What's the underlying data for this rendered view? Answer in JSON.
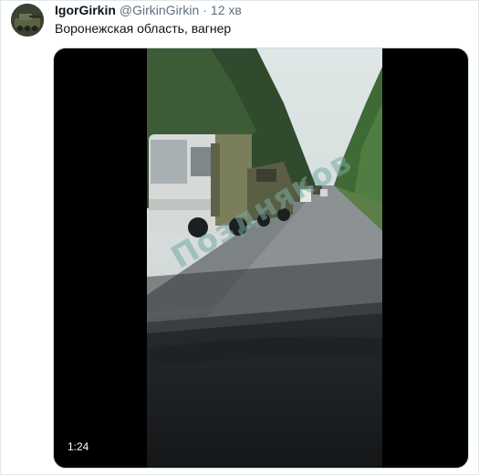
{
  "tweet": {
    "display_name": "IgorGirkin",
    "handle": "@GirkinGirkin",
    "separator": "·",
    "timestamp": "12 хв",
    "text": "Воронежская область, вагнер"
  },
  "media": {
    "type": "video",
    "duration": "1:24",
    "watermark": "Позднякoв"
  },
  "colors": {
    "text_primary": "#0f1419",
    "text_secondary": "#5b7083",
    "media_background": "#000000",
    "border": "#e1e8ed"
  }
}
